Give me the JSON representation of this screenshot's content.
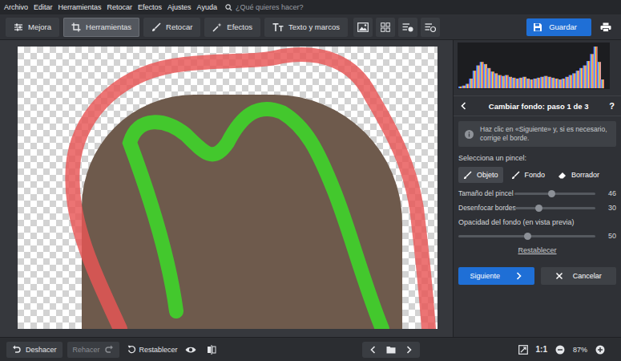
{
  "menu": [
    "Archivo",
    "Editar",
    "Herramientas",
    "Retocar",
    "Efectos",
    "Ajustes",
    "Ayuda"
  ],
  "search": {
    "placeholder": "¿Qué quieres hacer?"
  },
  "tabs": [
    {
      "label": "Mejora",
      "selected": false
    },
    {
      "label": "Herramientas",
      "selected": true
    },
    {
      "label": "Retocar",
      "selected": false
    },
    {
      "label": "Efectos",
      "selected": false
    },
    {
      "label": "Texto y marcos",
      "selected": false
    }
  ],
  "save_button": "Guardar",
  "histogram": {
    "values": [
      4,
      6,
      10,
      22,
      40,
      52,
      60,
      55,
      46,
      38,
      34,
      30,
      28,
      30,
      26,
      24,
      22,
      24,
      26,
      22,
      20,
      22,
      24,
      26,
      28,
      26,
      24,
      22,
      20,
      22,
      26,
      30,
      34,
      40,
      46,
      52,
      62,
      78,
      95,
      60,
      20
    ]
  },
  "panel": {
    "title": "Cambiar fondo: paso 1 de 3",
    "help": "?",
    "info": "Haz clic en «Siguiente» y, si es necesario, corrige el borde.",
    "brush_label": "Selecciona un pincel:",
    "brushes": [
      {
        "label": "Objeto",
        "selected": true
      },
      {
        "label": "Fondo",
        "selected": false
      },
      {
        "label": "Borrador",
        "selected": false
      }
    ],
    "sliders": [
      {
        "label": "Tamaño del pincel",
        "value": "46",
        "level": 0.46,
        "kind": "inline"
      },
      {
        "label": "Desenfocar bordes",
        "value": "30",
        "level": 0.3,
        "kind": "inline"
      },
      {
        "label": "Opacidad del fondo (en vista previa)",
        "value": "50",
        "level": 0.5,
        "kind": "stacked"
      }
    ],
    "reset": "Restablecer",
    "next": "Siguiente",
    "cancel": "Cancelar"
  },
  "bottom": {
    "undo": {
      "label": "Deshacer",
      "disabled": false
    },
    "redo": {
      "label": "Rehacer",
      "disabled": true
    },
    "reset": "Restablecer",
    "actual_size": "1:1",
    "zoom": "87%"
  }
}
